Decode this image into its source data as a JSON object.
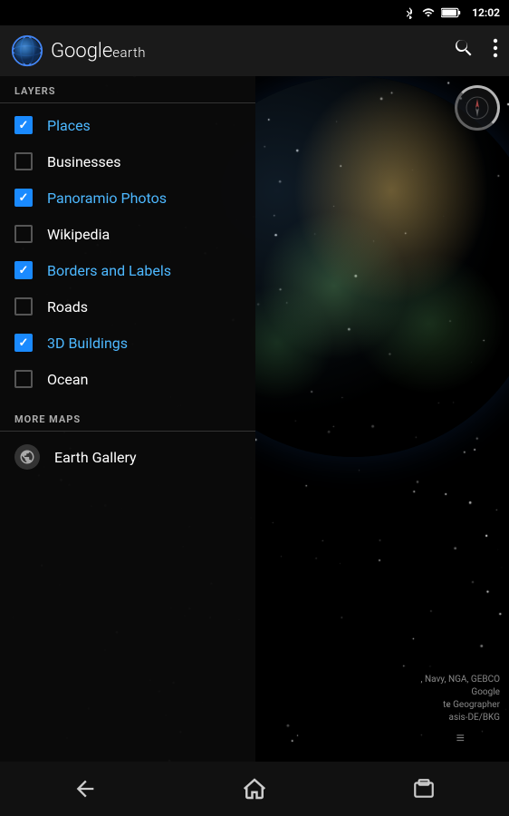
{
  "statusBar": {
    "time": "12:02",
    "bluetooth_icon": "bluetooth",
    "wifi_icon": "wifi",
    "battery_icon": "battery"
  },
  "topBar": {
    "logo_alt": "Google Earth Logo",
    "logo_google": "Google",
    "logo_earth": "earth",
    "search_icon": "search",
    "more_icon": "more-vertical"
  },
  "sidebar": {
    "layers_header": "LAYERS",
    "layers": [
      {
        "id": "places",
        "label": "Places",
        "checked": true,
        "active": true
      },
      {
        "id": "businesses",
        "label": "Businesses",
        "checked": false,
        "active": false
      },
      {
        "id": "panoramio",
        "label": "Panoramio Photos",
        "checked": true,
        "active": true
      },
      {
        "id": "wikipedia",
        "label": "Wikipedia",
        "checked": false,
        "active": false
      },
      {
        "id": "borders",
        "label": "Borders and Labels",
        "checked": true,
        "active": true
      },
      {
        "id": "roads",
        "label": "Roads",
        "checked": false,
        "active": false
      },
      {
        "id": "buildings",
        "label": "3D Buildings",
        "checked": true,
        "active": true
      },
      {
        "id": "ocean",
        "label": "Ocean",
        "checked": false,
        "active": false
      }
    ],
    "more_maps_header": "MORE MAPS",
    "more_maps": [
      {
        "id": "earth-gallery",
        "label": "Earth Gallery",
        "icon": "globe"
      }
    ]
  },
  "copyright": {
    "lines": [
      ", Navy, NGA, GEBCO",
      "Google",
      "te Geographer",
      "asis-DE/BKG"
    ]
  },
  "bottomNav": {
    "back_icon": "back-arrow",
    "home_icon": "home",
    "recents_icon": "recents"
  }
}
